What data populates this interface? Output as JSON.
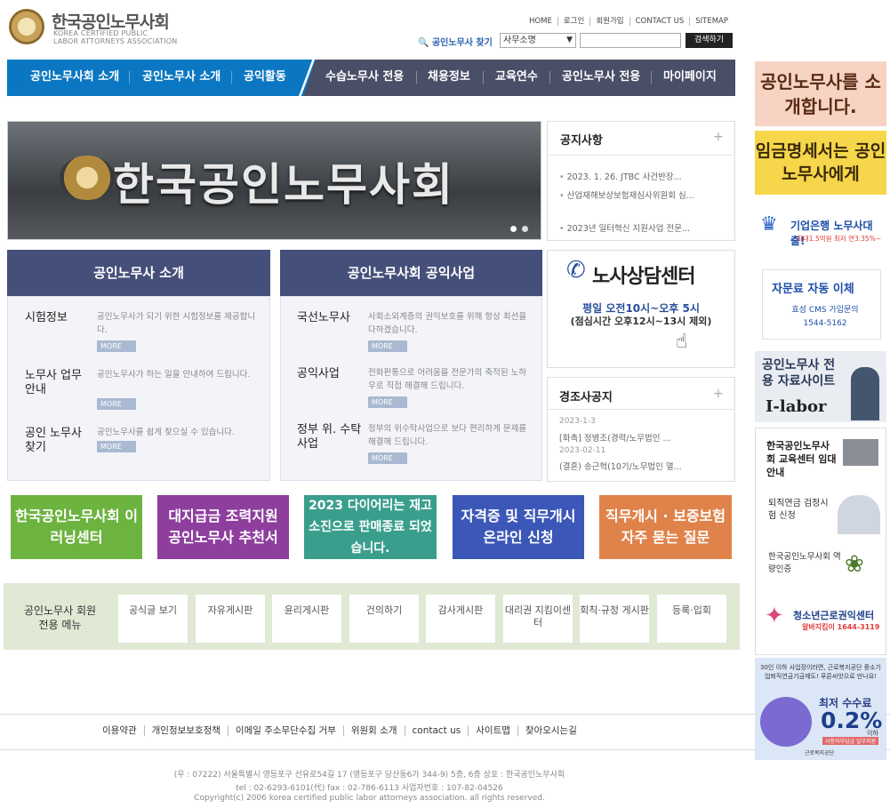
{
  "header": {
    "title": "한국공인노무사회",
    "subtitle_line1": "KOREA CERTIFIED PUBLIC",
    "subtitle_line2": "LABOR ATTORNEYS ASSOCIATION",
    "top_links": [
      "HOME",
      "로그인",
      "회원가입",
      "CONTACT US",
      "SITEMAP"
    ],
    "search_label": "공인노무사 찾기",
    "search_select": "사무소명",
    "search_button": "검색하기"
  },
  "gnb": {
    "items": [
      "공인노무사회 소개",
      "공인노무사 소개",
      "공익활동",
      "수습노무사 전용",
      "채용정보",
      "교육연수",
      "공인노무사 전용",
      "마이페이지"
    ]
  },
  "banner": {
    "text": "한국공인노무사회"
  },
  "notice": {
    "title": "공지사항",
    "items": [
      "2023. 1. 26. JTBC 사건반장...",
      "산업재해보상보험재심사위원회 심...",
      "2023년 일터혁신 지원사업 전문..."
    ]
  },
  "intro": {
    "title": "공인노무사 소개",
    "items": [
      {
        "title": "시험정보",
        "desc": "공인노무사가 되기 위한 시험정보를 제공합니다.",
        "more": "MORE"
      },
      {
        "title": "노무사 업무안내",
        "desc": "공인노무사가 하는 일을 안내하여 드립니다.",
        "more": "MORE"
      },
      {
        "title": "공인 노무사 찾기",
        "desc": "공인노무사를 쉽게 찾으실 수 있습니다.",
        "more": "MORE"
      }
    ]
  },
  "public": {
    "title": "공인노무사회 공익사업",
    "items": [
      {
        "title": "국선노무사",
        "desc": "사회소외계층의 권익보호를 위해 항상 최선을 다하겠습니다.",
        "more": "MORE"
      },
      {
        "title": "공익사업",
        "desc": "전화판통으로 어려움을 전문가의 축적된 노하우로 직접 해결해 드립니다.",
        "more": "MORE"
      },
      {
        "title": "정부 위. 수탁 사업",
        "desc": "정부의 위수탁사업으로 보다 편리하게 문제를 해결해 드립니다.",
        "more": "MORE"
      }
    ]
  },
  "counsel": {
    "title": "노사상담센터",
    "time": "평일 오전10시~오후 5시",
    "lunch": "(점심시간 오후12시~13시 제외)"
  },
  "condolence": {
    "title": "경조사공지",
    "items": [
      {
        "date": "2023-1-3",
        "text": "[화촉] 정병조(경력/노무법인 ..."
      },
      {
        "date": "2023-02-11",
        "text": "(결혼) 송근혁(10기/노무법인 열..."
      }
    ]
  },
  "quick_banners": [
    {
      "text": "한국공인노무사회 이러닝센터",
      "color": "#6cb33f"
    },
    {
      "text": "대지급금 조력지원 공인노무사 추천서",
      "color": "#8e3f9e"
    },
    {
      "text": "2023 다이어리는 재고소진으로 판매종료 되었습니다.",
      "color": "#3a9e8d"
    },
    {
      "text": "자격증 및 직무개시 온라인 신청",
      "color": "#3b57b8"
    },
    {
      "text": "직무개시 · 보증보험 자주 묻는 질문",
      "color": "#e0834a"
    }
  ],
  "member_menu": {
    "title": "공인노무사 회원 전용 메뉴",
    "items": [
      "공식글 보기",
      "자유게시판",
      "윤리게시판",
      "건의하기",
      "감사게시판",
      "대리권 지킴이센터",
      "회칙·규정 게시판",
      "등록·입회"
    ]
  },
  "footer": {
    "links": [
      "이용약관",
      "개인정보보호정책",
      "이메일 주소무단수집 거부",
      "위원회 소개",
      "contact us",
      "사이트맵",
      "찾아오시는길"
    ],
    "address": "(우 : 07222) 서울특별시 영등포구 선유로54길 17 (영등포구 당산동6가 344-9) 5층, 6층     상호 : 한국공인노무사회",
    "contact": "tel : 02-6293-6101(代)      fax : 02-786-6113      사업자번호 : 107-82-04526",
    "copyright": "Copyright(c) 2006 korea certified public labor attorneys association. all rights reserved."
  },
  "right_banners": [
    {
      "text": "공인노무사를 소개합니다."
    },
    {
      "text": "임금명세서는 공인노무사에게"
    },
    {
      "text": "기업은행 노무사대출!",
      "sub": "최대1.5억원 최저 연3.35%~"
    },
    {
      "text": "자문료 자동 이체",
      "sub": "효성 CMS 가입문의 1544-5162"
    },
    {
      "text": "공인노무사 전용 자료사이트",
      "sub": "I-labor"
    },
    {
      "text": "한국공인노무사회 교육센터 임대 안내",
      "sub1": "퇴직연금 검정시험 신청",
      "sub2": "한국공인노무사회 역량인증",
      "sub3": "청소년근로권익센터",
      "sub4": "알바지킴이 1644-3119"
    },
    {
      "text": "30인 이하 사업장이라면, 근로복지공단 중소기업퇴직연금기금제도! 푸른씨앗으로 만나요!",
      "big": "최저 수수료",
      "pct": "0.2%",
      "tail": "이하",
      "note": "사용자부담금 일부지원",
      "org": "근로복지공단"
    }
  ]
}
